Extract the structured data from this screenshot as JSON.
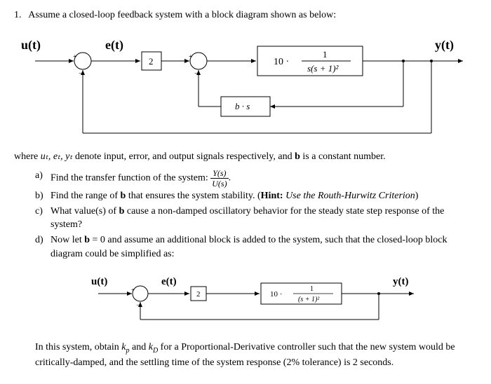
{
  "question": {
    "number": "1.",
    "prompt": "Assume a closed-loop feedback system with a block diagram shown as below:"
  },
  "diagram1": {
    "input": "u(t)",
    "error": "e(t)",
    "output": "y(t)",
    "block_gain": "2",
    "block_tf_prefix": "10 ·",
    "block_tf_num": "1",
    "block_tf_den": "s(s + 1)²",
    "block_fb": "b · s"
  },
  "where_text_1": "where ",
  "where_vars": "uₜ, eₜ, yₜ",
  "where_text_2": " denote input, error, and output signals respectively, and ",
  "where_bold": "b",
  "where_text_3": " is a constant number.",
  "parts": {
    "a": {
      "label": "a)",
      "text": "Find the transfer function of the system: ",
      "frac_num": "Y(s)",
      "frac_den": "U(s)",
      "trail": "."
    },
    "b": {
      "label": "b)",
      "text1": "Find the range of ",
      "bold1": "b",
      "text2": " that ensures the system stability. (",
      "hint_bold": "Hint:",
      "hint_ital": " Use the Routh-Hurwitz Criterion",
      "text3": ")"
    },
    "c": {
      "label": "c)",
      "text1": "What value(s) of ",
      "bold1": "b",
      "text2": " cause a non-damped oscillatory behavior for the steady state step response of the system?"
    },
    "d": {
      "label": "d)",
      "text1": "Now let ",
      "bold1": "b",
      "text2": " = 0 and assume an additional block is added to the system, such that the closed-loop block diagram could be simplified as:"
    }
  },
  "diagram2": {
    "input": "u(t)",
    "error": "e(t)",
    "output": "y(t)",
    "block_gain": "2",
    "block_tf_prefix": "10 ·",
    "block_tf_num": "1",
    "block_tf_den": "(s + 1)²"
  },
  "after_text_1": "In this system, obtain ",
  "after_kp": "k",
  "after_kp_sub": "p",
  "after_text_2": " and ",
  "after_kd": "k",
  "after_kd_sub": "D",
  "after_text_3": " for a Proportional-Derivative controller such that the new system would be critically-damped, and the settling time of the system response (2% tolerance) is 2 seconds."
}
